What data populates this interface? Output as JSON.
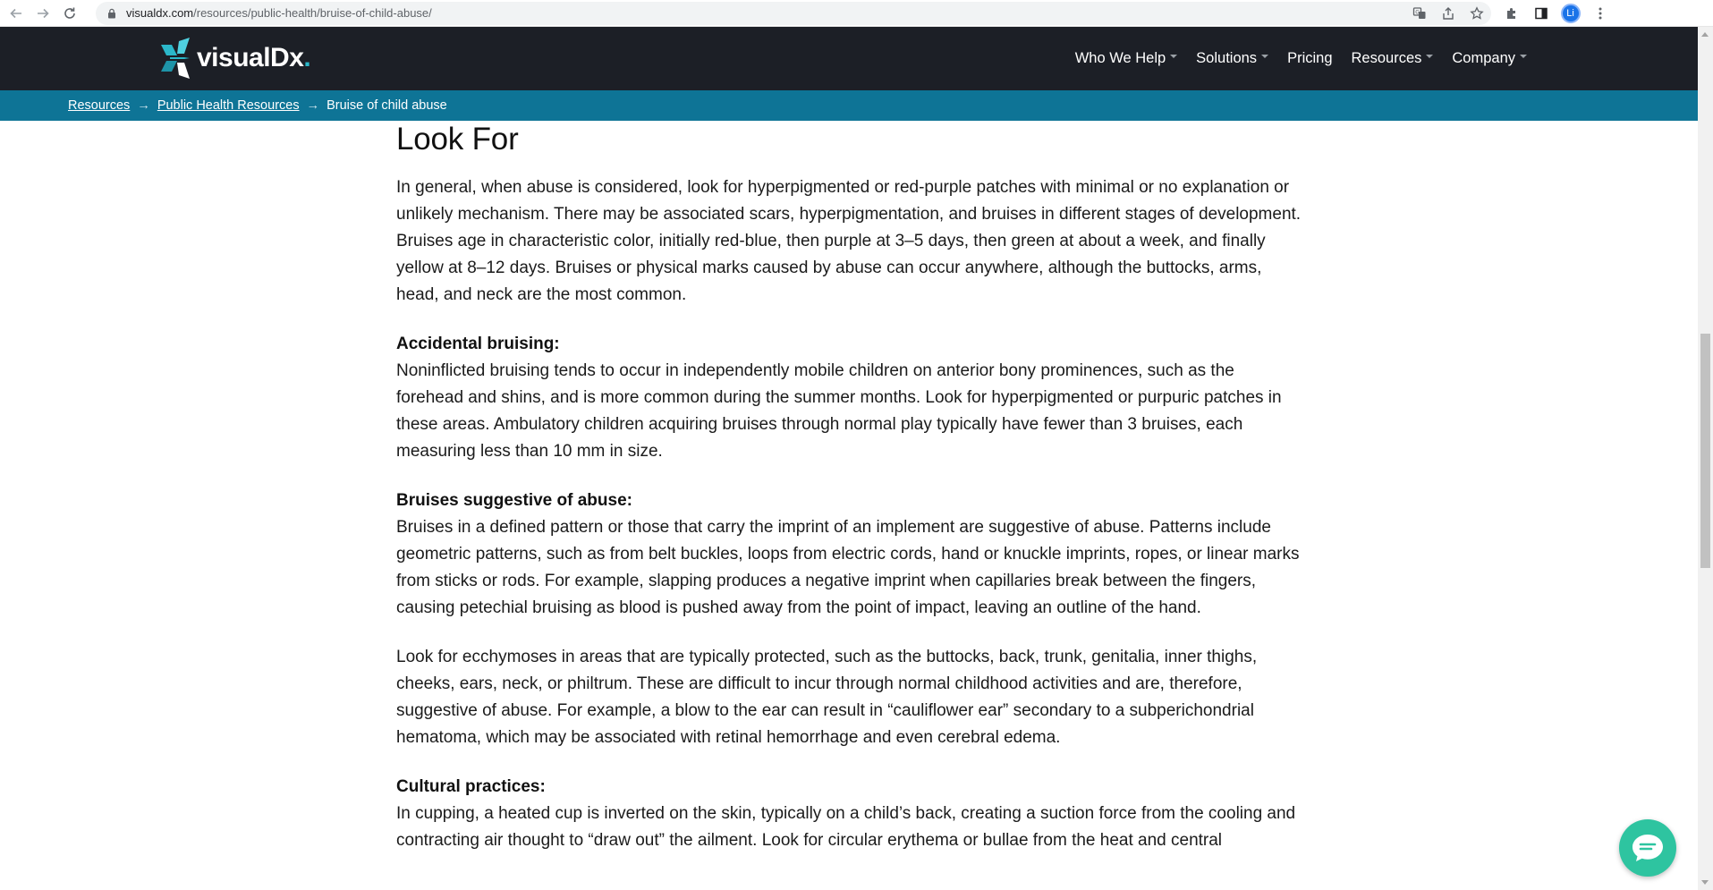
{
  "browser": {
    "url_host": "visualdx.com",
    "url_path": "/resources/public-health/bruise-of-child-abuse/",
    "profile_initials": "Li"
  },
  "header": {
    "logo_text": "visualDx",
    "logo_dot": ".",
    "nav": [
      {
        "label": "Who We Help",
        "has_dropdown": true
      },
      {
        "label": "Solutions",
        "has_dropdown": true
      },
      {
        "label": "Pricing",
        "has_dropdown": false
      },
      {
        "label": "Resources",
        "has_dropdown": true
      },
      {
        "label": "Company",
        "has_dropdown": true
      }
    ]
  },
  "breadcrumb": {
    "items": [
      "Resources",
      "Public Health Resources"
    ],
    "current": "Bruise of child abuse",
    "separator": "→"
  },
  "article": {
    "heading": "Look For",
    "intro": "In general, when abuse is considered, look for hyperpigmented or red-purple patches with minimal or no explanation or unlikely mechanism. There may be associated scars, hyperpigmentation, and bruises in different stages of development. Bruises age in characteristic color, initially red-blue, then purple at 3–5 days, then green at about a week, and finally yellow at 8–12 days. Bruises or physical marks caused by abuse can occur anywhere, although the buttocks, arms, head, and neck are the most common.",
    "accidental_heading": "Accidental bruising:",
    "accidental_text": "Noninflicted bruising tends to occur in independently mobile children on anterior bony prominences, such as the forehead and shins, and is more common during the summer months. Look for hyperpigmented or purpuric patches in these areas. Ambulatory children acquiring bruises through normal play typically have fewer than 3 bruises, each measuring less than 10 mm in size.",
    "suggestive_heading": "Bruises suggestive of abuse:",
    "suggestive_text": "Bruises in a defined pattern or those that carry the imprint of an implement are suggestive of abuse. Patterns include geometric patterns, such as from belt buckles, loops from electric cords, hand or knuckle imprints, ropes, or linear marks from sticks or rods. For example, slapping produces a negative imprint when capillaries break between the fingers, causing petechial bruising as blood is pushed away from the point of impact, leaving an outline of the hand.",
    "ecchymoses_text": "Look for ecchymoses in areas that are typically protected, such as the buttocks, back, trunk, genitalia, inner thighs, cheeks, ears, neck, or philtrum. These are difficult to incur through normal childhood activities and are, therefore, suggestive of abuse. For example, a blow to the ear can result in “cauliflower ear” secondary to a subperichondrial hematoma, which may be associated with retinal hemorrhage and even cerebral edema.",
    "cultural_heading": "Cultural practices:",
    "cultural_text": "In cupping, a heated cup is inverted on the skin, typically on a child’s back, creating a suction force from the cooling and contracting air thought to “draw out” the ailment. Look for circular erythema or bullae from the heat and central"
  },
  "colors": {
    "header_bg": "#1c1f26",
    "breadcrumb_bg": "#0e7496",
    "brand_teal": "#2bb7c9",
    "chat_green": "#2ec4a0"
  },
  "icons": [
    "back-arrow-icon",
    "forward-arrow-icon",
    "reload-icon",
    "lock-icon",
    "translate-icon",
    "share-icon",
    "bookmark-star-icon",
    "extensions-puzzle-icon",
    "sidebar-icon",
    "profile-avatar",
    "menu-dots-icon",
    "chat-icon"
  ]
}
